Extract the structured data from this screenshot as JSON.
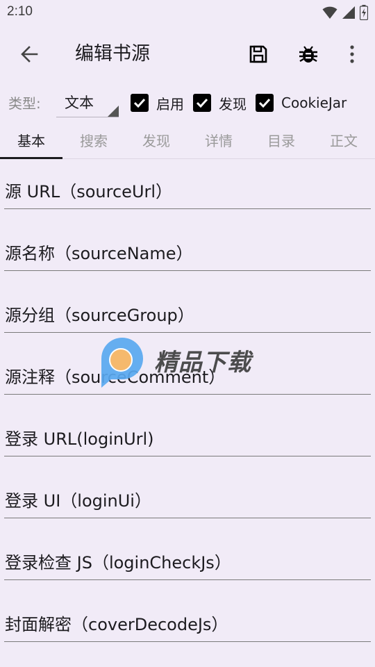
{
  "status_bar": {
    "time": "2:10"
  },
  "app_bar": {
    "title": "编辑书源",
    "icons": [
      "back-arrow-icon",
      "save-icon",
      "bug-icon",
      "more-vert-icon"
    ]
  },
  "options": {
    "type_label": "类型:",
    "type_value": "文本",
    "checkboxes": [
      {
        "label": "启用",
        "checked": true
      },
      {
        "label": "发现",
        "checked": true
      },
      {
        "label": "CookieJar",
        "checked": true
      }
    ]
  },
  "tabs": [
    {
      "label": "基本",
      "active": true
    },
    {
      "label": "搜索",
      "active": false
    },
    {
      "label": "发现",
      "active": false
    },
    {
      "label": "详情",
      "active": false
    },
    {
      "label": "目录",
      "active": false
    },
    {
      "label": "正文",
      "active": false
    }
  ],
  "fields": [
    {
      "label": "源 URL（sourceUrl）"
    },
    {
      "label": "源名称（sourceName）"
    },
    {
      "label": "源分组（sourceGroup）"
    },
    {
      "label": "源注释（sourceComment）"
    },
    {
      "label": "登录 URL(loginUrl)"
    },
    {
      "label": "登录 UI（loginUi）"
    },
    {
      "label": "登录检查 JS（loginCheckJs）"
    },
    {
      "label": "封面解密（coverDecodeJs）"
    }
  ],
  "watermark": {
    "text": "精品下载"
  },
  "colors": {
    "background": "#f1ebf7",
    "text": "#1c1b1f",
    "inactive_tab": "#9a9a9a",
    "checkbox": "#000000"
  }
}
